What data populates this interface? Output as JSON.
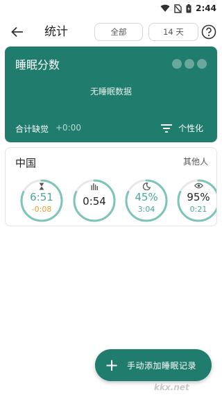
{
  "status_bar": {
    "time": "2:44"
  },
  "app_bar": {
    "title": "统计",
    "range_filter": "全部",
    "days_filter": "14 天"
  },
  "sleep_score_card": {
    "title": "睡眠分数",
    "empty_text": "无睡眠数据",
    "total_deficit_label": "合计缺觉",
    "total_deficit_value": "+0:00",
    "personalize_label": "个性化",
    "colors": {
      "background": "#207c6c",
      "dots": "#6aa89c"
    }
  },
  "country_card": {
    "title": "中国",
    "others_label": "其他人",
    "gauges": [
      {
        "icon": "hourglass-icon",
        "main": "6:51",
        "sub": "-0:08",
        "main_color": "#4aa79a",
        "sub_color": "#e1a032",
        "arc": 0.82
      },
      {
        "icon": "bars-icon",
        "main": "0:54",
        "sub": "",
        "main_color": "#222222",
        "sub_color": "#4aa79a",
        "arc": 0.82
      },
      {
        "icon": "moon-icon",
        "main": "45%",
        "sub": "3:04",
        "main_color": "#4aa79a",
        "sub_color": "#4aa79a",
        "arc": 0.82
      },
      {
        "icon": "eye-icon",
        "main": "95%",
        "sub": "0:21",
        "main_color": "#222222",
        "sub_color": "#4aa79a",
        "arc": 0.82
      }
    ]
  },
  "fab": {
    "label": "手动添加睡眠记录"
  },
  "watermark": "kkx.net",
  "accent_color": "#207c6c"
}
